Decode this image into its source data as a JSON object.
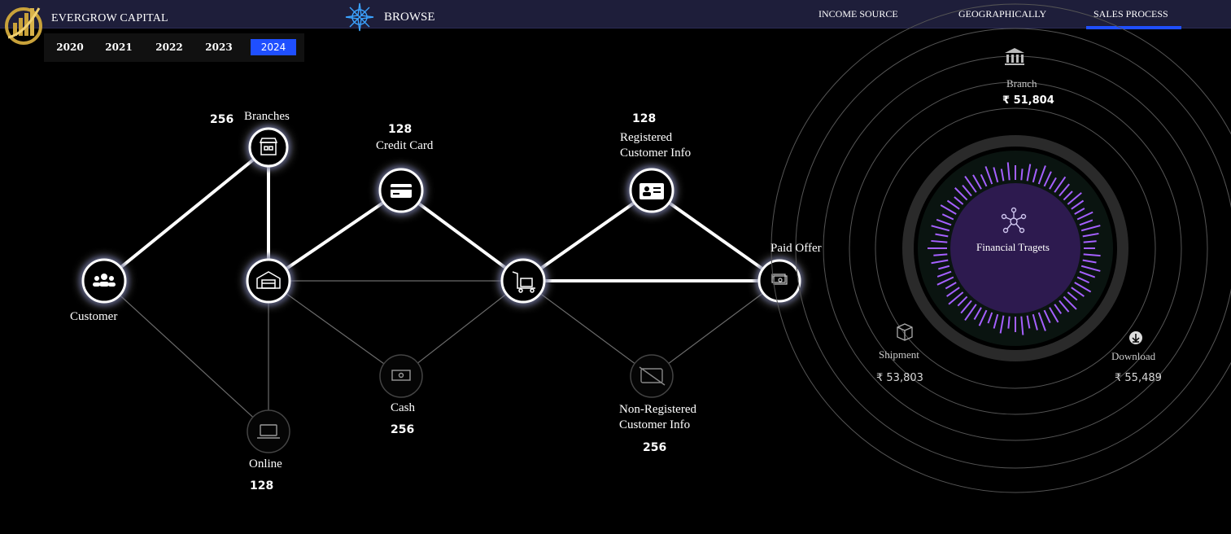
{
  "header": {
    "brand": "EVERGROW CAPITAL",
    "browse": "BROWSE",
    "tabs": [
      {
        "label": "INCOME SOURCE"
      },
      {
        "label": "GEOGRAPHICALLY"
      },
      {
        "label": "SALES PROCESS",
        "active": true
      }
    ]
  },
  "years": {
    "items": [
      "2020",
      "2021",
      "2022",
      "2023",
      "2024"
    ],
    "selected": "2024"
  },
  "flow": {
    "customer": {
      "label": "Customer"
    },
    "branches": {
      "label": "Branches",
      "value": "256"
    },
    "online": {
      "label": "Online",
      "value": "128"
    },
    "credit_card": {
      "label": "Credit Card",
      "value": "128"
    },
    "cash": {
      "label": "Cash",
      "value": "256"
    },
    "registered": {
      "label_line1": "Registered",
      "label_line2": "Customer Info",
      "value": "128"
    },
    "non_registered": {
      "label_line1": "Non-Registered",
      "label_line2": "Customer Info",
      "value": "256"
    },
    "paid_offer": {
      "label": "Paid Offer"
    }
  },
  "targets": {
    "center": "Financial Tragets",
    "branch": {
      "label": "Branch",
      "value": "₹ 51,804"
    },
    "shipment": {
      "label": "Shipment",
      "value": "₹ 53,803"
    },
    "download": {
      "label": "Download",
      "value": "₹ 55,489"
    }
  },
  "colors": {
    "accent": "#1f4fff",
    "glow": "#2a4dff",
    "purple": "#a560ff",
    "center_fill": "#2d1a4f"
  }
}
